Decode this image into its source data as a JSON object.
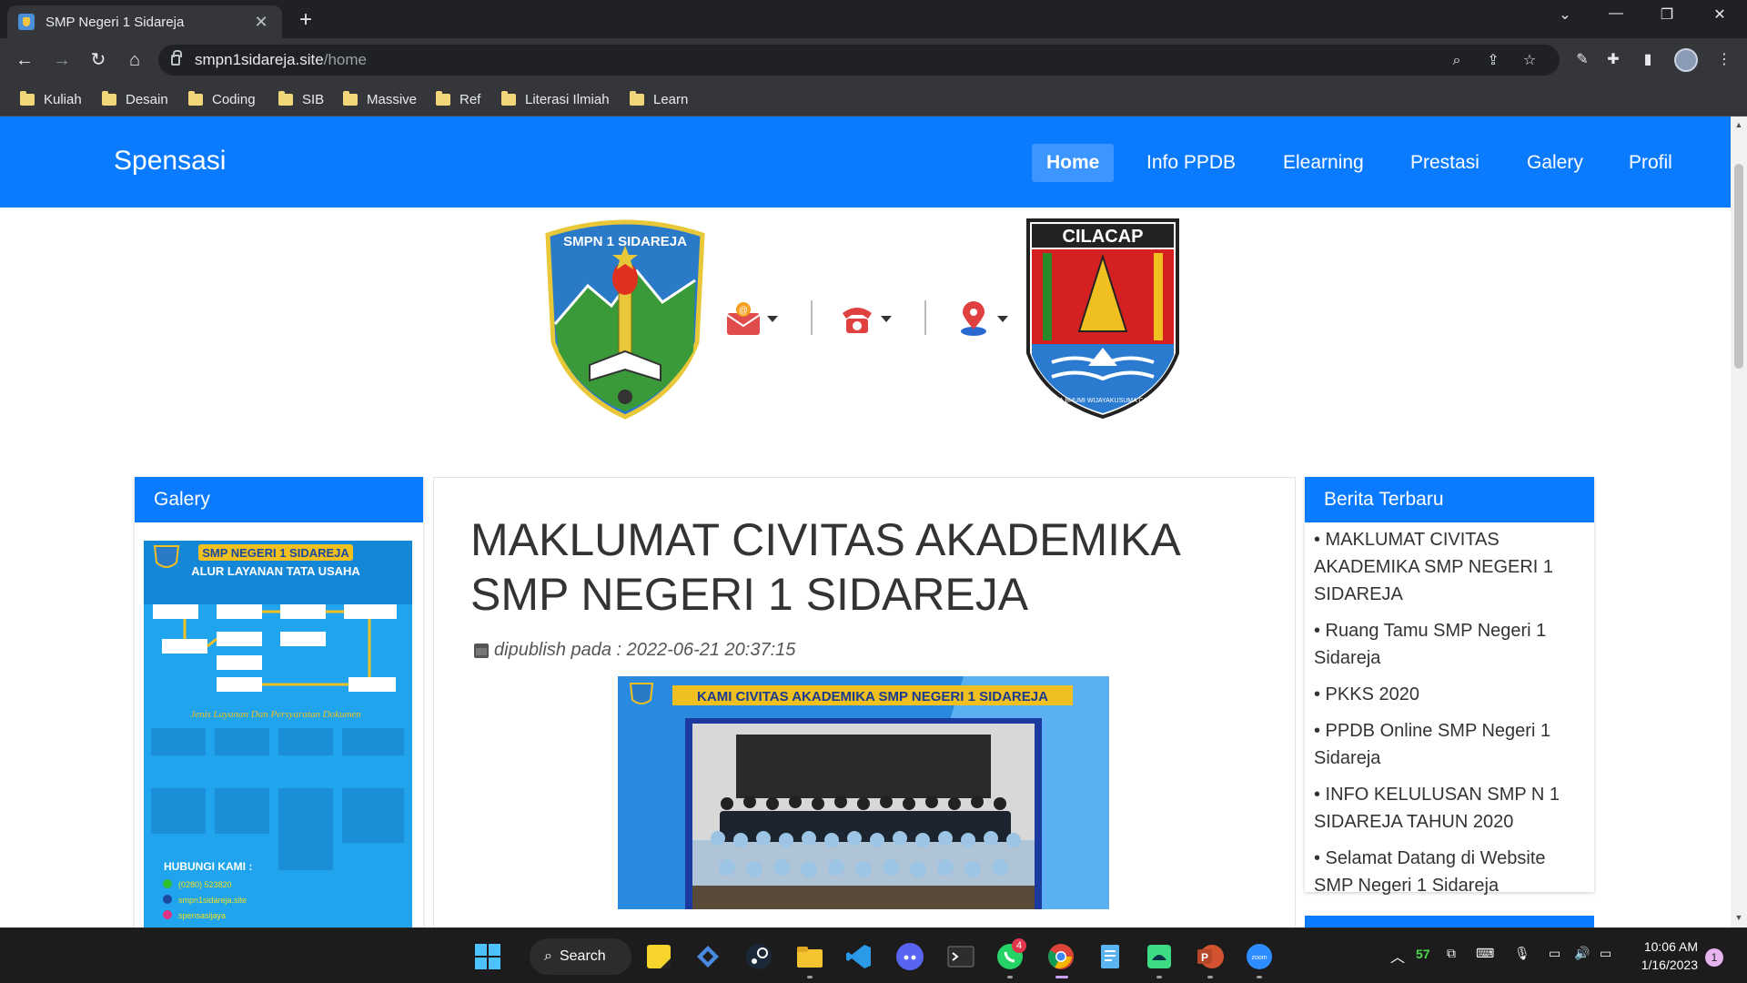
{
  "browser": {
    "tab_title": "SMP Negeri 1 Sidareja",
    "url_host": "smpn1sidareja.site",
    "url_path": "/home",
    "bookmarks": [
      "Kuliah",
      "Desain",
      "Coding",
      "SIB",
      "Massive",
      "Ref",
      "Literasi Ilmiah",
      "Learn"
    ]
  },
  "site": {
    "brand": "Spensasi",
    "nav": [
      "Home",
      "Info PPDB",
      "Elearning",
      "Prestasi",
      "Galery",
      "Profil"
    ],
    "active_nav": "Home",
    "logo_left_text": "SMPN 1 SIDAREJA",
    "logo_right_text": "CILACAP",
    "logo_right_motto": "JALA BHUMI WIJAYAKUSUMA CAKTI"
  },
  "gallery": {
    "heading": "Galery",
    "poster": {
      "school": "SMP NEGERI 1 SIDAREJA",
      "subtitle": "ALUR LAYANAN TATA USAHA",
      "section": "Jenis Layanan Dan Persyaratan Dokumen",
      "contact_heading": "HUBUNGI KAMI :",
      "phone": "(0280) 523820",
      "web": "smpn1sidareja.site",
      "social": "spensasijaya"
    }
  },
  "article": {
    "title": "MAKLUMAT CIVITAS AKADEMIKA SMP NEGERI 1 SIDAREJA",
    "meta": "dipublish pada : 2022-06-21 20:37:15",
    "image_banner": "KAMI CIVITAS AKADEMIKA SMP NEGERI 1 SIDAREJA"
  },
  "news": {
    "heading": "Berita Terbaru",
    "items": [
      "• MAKLUMAT CIVITAS AKADEMIKA SMP NEGERI 1 SIDAREJA",
      "• Ruang Tamu SMP Negeri 1 Sidareja",
      "• PKKS 2020",
      "• PPDB Online SMP Negeri 1 Sidareja",
      "• INFO KELULUSAN SMP N 1 SIDAREJA TAHUN 2020",
      "• Selamat Datang di Website SMP Negeri 1 Sidareja"
    ]
  },
  "taskbar": {
    "search_label": "Search",
    "whatsapp_badge": "4",
    "tray_temp": "57",
    "time": "10:06 AM",
    "date": "1/16/2023",
    "notification_count": "1"
  },
  "colors": {
    "brand_blue": "#0a7bff",
    "chrome_dark": "#35363a"
  }
}
